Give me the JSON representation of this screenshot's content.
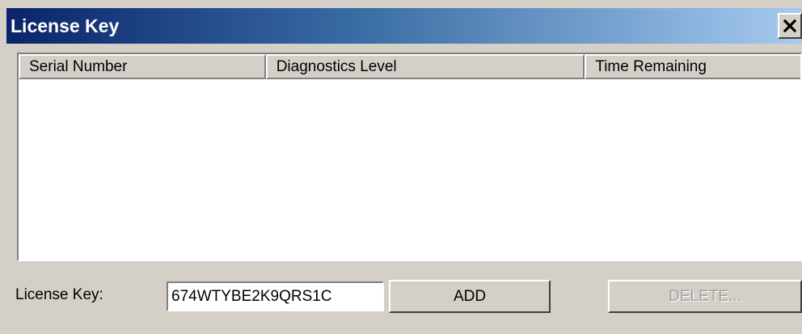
{
  "window": {
    "title": "License Key"
  },
  "titlebar": {
    "close_icon": "close-icon"
  },
  "listview": {
    "columns": [
      "Serial Number",
      "Diagnostics Level",
      "Time Remaining"
    ],
    "rows": []
  },
  "form": {
    "license_label": "License Key:",
    "license_value": "674WTYBE2K9QRS1C",
    "add_label": "ADD",
    "delete_label": "DELETE...",
    "delete_enabled": false
  },
  "colors": {
    "title_gradient_start": "#0a246a",
    "title_gradient_end": "#a6caf0",
    "face": "#d4d0c8"
  }
}
